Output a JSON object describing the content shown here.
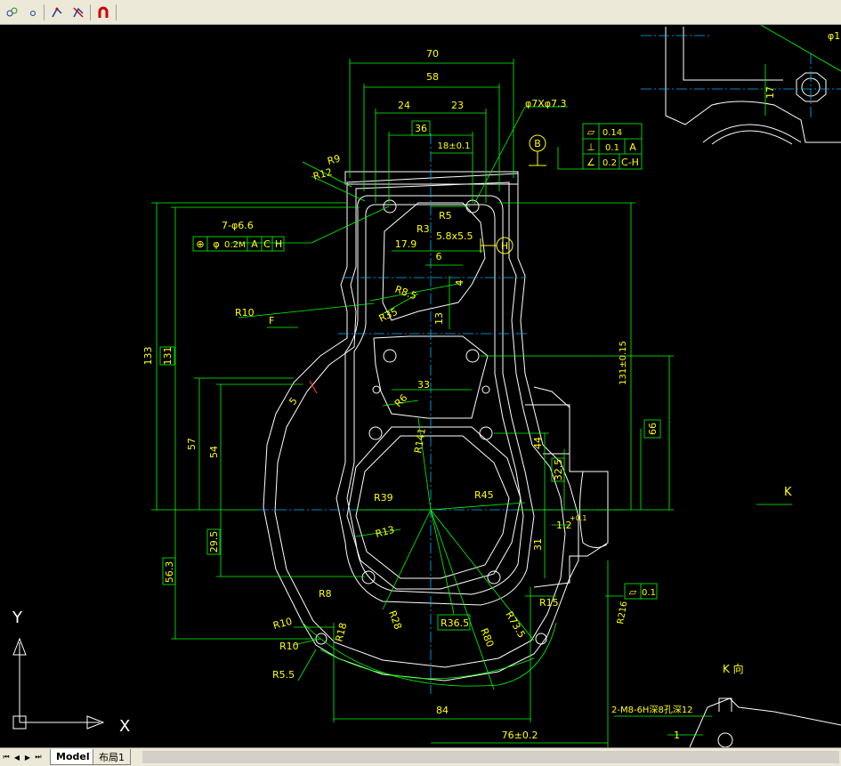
{
  "toolbar": {
    "buttons": [
      {
        "name": "layer-states-icon",
        "glyph": "⛭"
      },
      {
        "name": "layer-off-icon",
        "glyph": "∘"
      },
      {
        "name": "match-properties-icon",
        "glyph": "⤢"
      },
      {
        "name": "layer-isolate-icon",
        "glyph": "⊘"
      },
      {
        "name": "magnet-icon",
        "glyph": "∩"
      }
    ]
  },
  "drawing": {
    "dims": {
      "d70": "70",
      "d58": "58",
      "d24": "24",
      "d23": "23",
      "d36": "36",
      "d18": "18±0.1",
      "d133": "133",
      "d131": "131",
      "d57": "57",
      "d54": "54",
      "d29_5": "29.5",
      "d56_3": "56.3",
      "d84": "84",
      "d76": "76±0.2",
      "d131b": "131±0.15",
      "d66": "66",
      "d44": "44",
      "d32_5": "32.5",
      "d31": "31",
      "d1_2": "1.2",
      "d1_2tol": "+0.1",
      "d17_9": "17.9",
      "d6": "6",
      "d4": "4",
      "d13": "13",
      "d33": "33",
      "d5": "5",
      "d17": "17",
      "d1": "1",
      "phi_r": "φ1"
    },
    "radii": {
      "r9": "R9",
      "r12": "R12",
      "r5": "R5",
      "r3": "R3",
      "r8_5": "R8.5",
      "r35": "R35",
      "r10a": "R10",
      "r6": "R6",
      "r141": "R141",
      "r39": "R39",
      "r45": "R45",
      "r13": "R13",
      "r8": "R8",
      "r15": "R15",
      "r28": "R28",
      "r36_5": "R36.5",
      "r73_5": "R73.5",
      "r80": "R80",
      "r10b": "R10",
      "r10c": "R10",
      "r18": "R18",
      "r5_5": "R5.5",
      "r216": "R216"
    },
    "notes": {
      "hole_7": "7-φ6.6",
      "phi7x": "φ7Xφ7.3",
      "slot": "5.8x5.5",
      "f_label": "F",
      "k_label": "K",
      "k_view": "K 向",
      "thread": "2-M8-6H深8孔深12"
    },
    "datums": {
      "b": "B",
      "h": "H"
    },
    "fcf_main": {
      "sym": "⊕",
      "dia": "φ",
      "tol": "0.2",
      "mod": "M",
      "ref1": "A",
      "ref2": "C",
      "ref3": "H"
    },
    "fcf_right": {
      "row1_sym": "▱",
      "row1_tol": "0.14",
      "row2_sym": "⊥",
      "row2_tol": "0.1",
      "row2_ref": "A",
      "row3_sym": "∠",
      "row3_tol": "0.2",
      "row3_ref": "C-H"
    },
    "fcf_flat": {
      "sym": "▱",
      "tol": "0.1"
    },
    "ucs": {
      "y": "Y",
      "x": "X"
    }
  },
  "tabs": {
    "model": "Model",
    "layout1": "布局1"
  },
  "colors": {
    "bg": "#000000",
    "geometry": "#ffffff",
    "dims": "#00ff00",
    "text": "#ffff00",
    "center": "#00ffff",
    "ucs": "#ffffff"
  }
}
